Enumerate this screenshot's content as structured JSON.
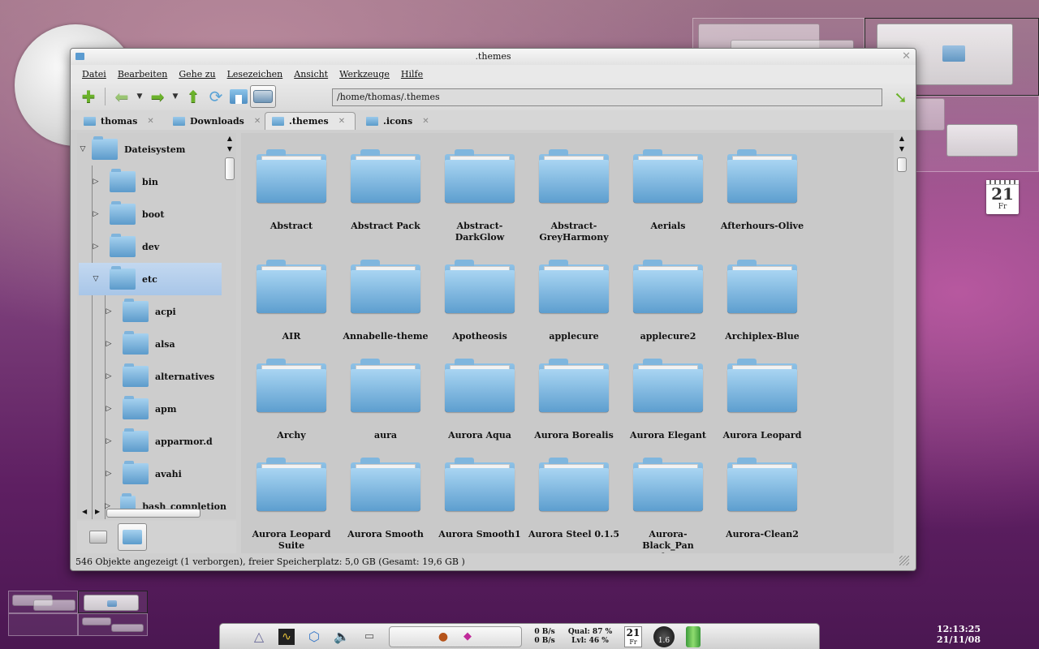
{
  "window": {
    "title": ".themes",
    "close_glyph": "✕",
    "menu": [
      "Datei",
      "Bearbeiten",
      "Gehe zu",
      "Lesezeichen",
      "Ansicht",
      "Werkzeuge",
      "Hilfe"
    ],
    "address": "/home/thomas/.themes"
  },
  "toolbar": {
    "icons": [
      "new-tab-plus-icon",
      "back-arrow-icon",
      "forward-arrow-icon",
      "up-arrow-icon",
      "reload-icon",
      "home-icon",
      "drive-icon",
      "go-arrow-icon"
    ]
  },
  "tabs": [
    {
      "label": "thomas",
      "active": false
    },
    {
      "label": "Downloads",
      "active": false
    },
    {
      "label": ".themes",
      "active": true
    },
    {
      "label": ".icons",
      "active": false
    }
  ],
  "tree": {
    "root": "Dateisystem",
    "items": [
      {
        "label": "bin",
        "level": 1,
        "expanded": false
      },
      {
        "label": "boot",
        "level": 1,
        "expanded": false
      },
      {
        "label": "dev",
        "level": 1,
        "expanded": false
      },
      {
        "label": "etc",
        "level": 1,
        "expanded": true,
        "selected": true
      },
      {
        "label": "acpi",
        "level": 2,
        "expanded": false
      },
      {
        "label": "alsa",
        "level": 2,
        "expanded": false
      },
      {
        "label": "alternatives",
        "level": 2,
        "expanded": false
      },
      {
        "label": "apm",
        "level": 2,
        "expanded": false
      },
      {
        "label": "apparmor.d",
        "level": 2,
        "expanded": false
      },
      {
        "label": "avahi",
        "level": 2,
        "expanded": false
      },
      {
        "label": "bash_completion",
        "level": 2,
        "expanded": false
      }
    ]
  },
  "folders": [
    [
      "Abstract",
      "Abstract Pack",
      "Abstract-DarkGlow",
      "Abstract-GreyHarmony",
      "Aerials",
      "Afterhours-Olive"
    ],
    [
      "AIR",
      "Annabelle-theme",
      "Apotheosis",
      "applecure",
      "applecure2",
      "Archiplex-Blue"
    ],
    [
      "Archy",
      "aura",
      "Aurora Aqua",
      "Aurora Borealis",
      "Aurora Elegant",
      "Aurora Leopard"
    ],
    [
      "Aurora Leopard Suite",
      "Aurora Smooth",
      "Aurora Smooth1",
      "Aurora Steel 0.1.5",
      "Aurora-Black_Panther",
      "Aurora-Clean2"
    ]
  ],
  "status": "546 Objekte angezeigt (1 verborgen), freier Speicherplatz: 5,0 GB (Gesamt: 19,6 GB )",
  "desktop": {
    "calendar_day": "21",
    "calendar_weekday": "Fr"
  },
  "panel": {
    "net_up": "0 B/s",
    "net_down": "0 B/s",
    "wifi_quality": "Qual: 87 %",
    "wifi_level": "Lvl: 46 %",
    "cal_day": "21",
    "cal_weekday": "Fr",
    "load": "1.6"
  },
  "clock": {
    "time": "12:13:25",
    "date": "21/11/08"
  }
}
